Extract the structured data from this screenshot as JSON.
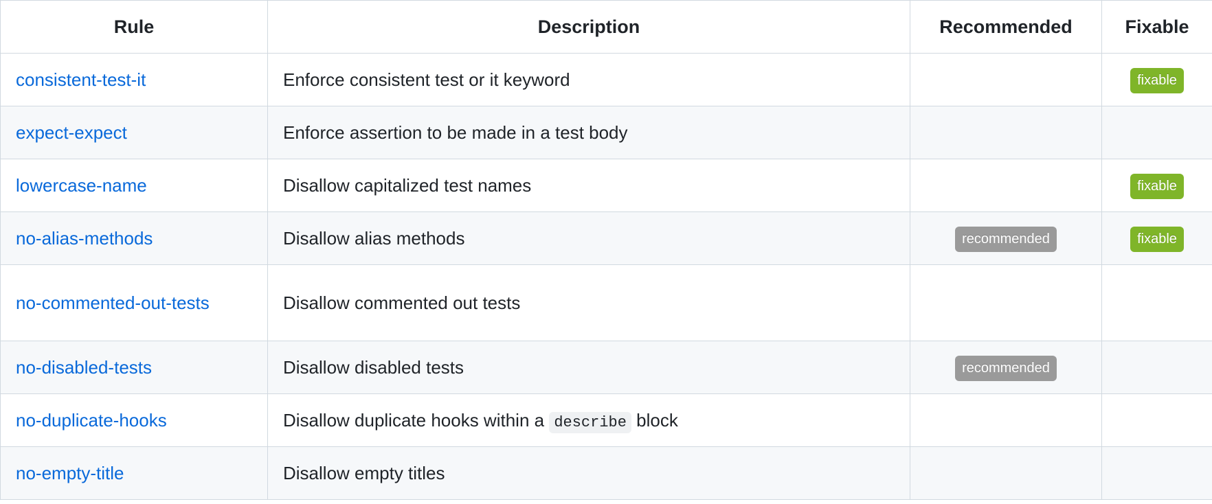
{
  "table": {
    "columns": [
      {
        "key": "rule",
        "label": "Rule"
      },
      {
        "key": "description",
        "label": "Description"
      },
      {
        "key": "recommended",
        "label": "Recommended"
      },
      {
        "key": "fixable",
        "label": "Fixable"
      }
    ],
    "badges": {
      "fixable_label": "fixable",
      "recommended_label": "recommended",
      "fixable_color": "#7fb529",
      "recommended_color": "#9a9a9a"
    },
    "link_color": "#0969da",
    "alt_row_color": "#f6f8fa",
    "border_color": "#d1d9e0",
    "rows": [
      {
        "rule": "consistent-test-it",
        "description_before": "Enforce consistent test or it keyword",
        "description_code": "",
        "description_after": "",
        "recommended": "",
        "fixable": "fixable"
      },
      {
        "rule": "expect-expect",
        "description_before": "Enforce assertion to be made in a test body",
        "description_code": "",
        "description_after": "",
        "recommended": "",
        "fixable": ""
      },
      {
        "rule": "lowercase-name",
        "description_before": "Disallow capitalized test names",
        "description_code": "",
        "description_after": "",
        "recommended": "",
        "fixable": "fixable"
      },
      {
        "rule": "no-alias-methods",
        "description_before": "Disallow alias methods",
        "description_code": "",
        "description_after": "",
        "recommended": "recommended",
        "fixable": "fixable"
      },
      {
        "rule": "no-commented-out-tests",
        "description_before": "Disallow commented out tests",
        "description_code": "",
        "description_after": "",
        "recommended": "",
        "fixable": ""
      },
      {
        "rule": "no-disabled-tests",
        "description_before": "Disallow disabled tests",
        "description_code": "",
        "description_after": "",
        "recommended": "recommended",
        "fixable": ""
      },
      {
        "rule": "no-duplicate-hooks",
        "description_before": "Disallow duplicate hooks within a ",
        "description_code": "describe",
        "description_after": " block",
        "recommended": "",
        "fixable": ""
      },
      {
        "rule": "no-empty-title",
        "description_before": "Disallow empty titles",
        "description_code": "",
        "description_after": "",
        "recommended": "",
        "fixable": ""
      }
    ]
  }
}
